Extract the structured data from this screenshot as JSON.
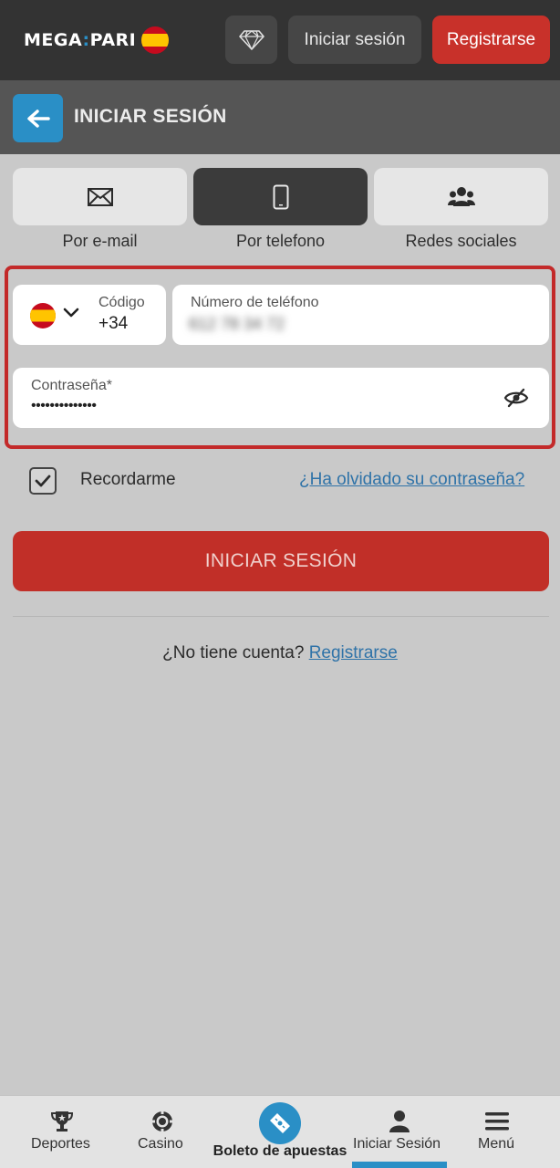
{
  "header": {
    "logo_left": "MEGA",
    "logo_sep": ":",
    "logo_right": "PARI",
    "login_label": "Iniciar sesión",
    "register_label": "Registrarse"
  },
  "titlebar": {
    "title": "INICIAR SESIÓN"
  },
  "methods": [
    {
      "label": "Por e-mail",
      "icon": "envelope-icon",
      "active": false
    },
    {
      "label": "Por telefono",
      "icon": "phone-icon",
      "active": true
    },
    {
      "label": "Redes sociales",
      "icon": "users-icon",
      "active": false
    }
  ],
  "form": {
    "code_label": "Código",
    "code_value": "+34",
    "phone_label": "Número de teléfono",
    "phone_value": "612 78 34 72",
    "password_label": "Contraseña*",
    "password_value": "••••••••••••••",
    "remember_label": "Recordarme",
    "remember_checked": true,
    "forgot_link": "¿Ha olvidado su contraseña?",
    "submit_label": "INICIAR SESIÓN",
    "no_account_text": "¿No tiene cuenta?",
    "register_link": "Registrarse"
  },
  "bottom_nav": {
    "items": [
      {
        "label": "Deportes",
        "icon": "trophy-icon"
      },
      {
        "label": "Casino",
        "icon": "casino-chip-icon"
      },
      {
        "label": "Boleto de apuestas",
        "icon": "ticket-icon"
      },
      {
        "label": "Iniciar Sesión",
        "icon": "user-icon"
      },
      {
        "label": "Menú",
        "icon": "hamburger-icon"
      }
    ],
    "active_index": 3
  },
  "colors": {
    "brand_red": "#c8312a",
    "accent_blue": "#2a8fc6",
    "dark_bar": "#333333",
    "title_bar": "#555555",
    "page_bg": "#c9c9c9"
  }
}
